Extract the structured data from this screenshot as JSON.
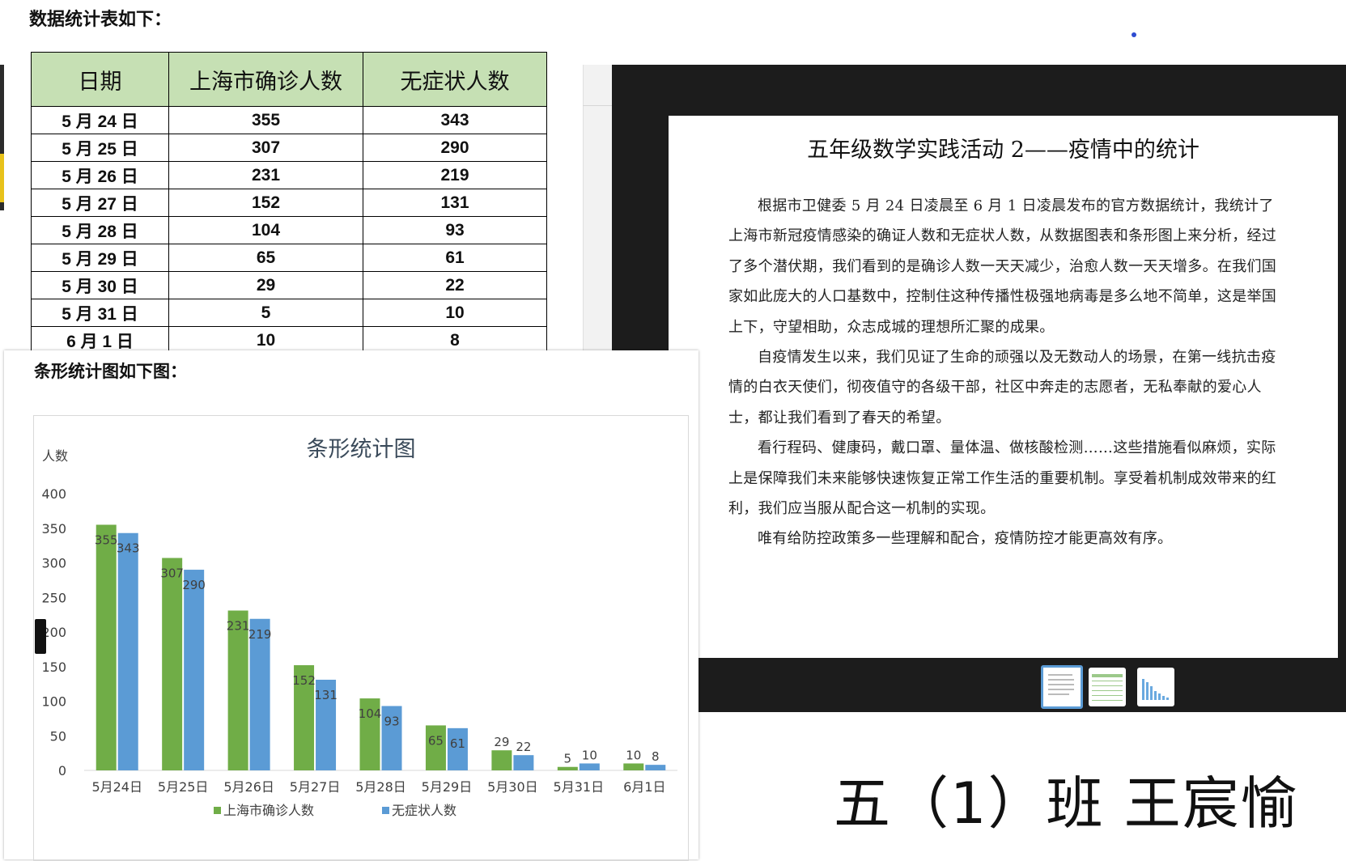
{
  "table_doc": {
    "heading": "数据统计表如下：",
    "headers": [
      "日期",
      "上海市确诊人数",
      "无症状人数"
    ],
    "rows": [
      [
        "5 月 24 日",
        "355",
        "343"
      ],
      [
        "5 月 25 日",
        "307",
        "290"
      ],
      [
        "5 月 26 日",
        "231",
        "219"
      ],
      [
        "5 月 27 日",
        "152",
        "131"
      ],
      [
        "5 月 28 日",
        "104",
        "93"
      ],
      [
        "5 月 29 日",
        "65",
        "61"
      ],
      [
        "5 月 30 日",
        "29",
        "22"
      ],
      [
        "5 月 31 日",
        "5",
        "10"
      ],
      [
        "6 月 1 日",
        "10",
        "8"
      ]
    ]
  },
  "chart_doc": {
    "heading": "条形统计图如下图："
  },
  "chart_data": {
    "type": "bar",
    "title": "条形统计图",
    "ylabel": "人数",
    "xlabel": "",
    "categories": [
      "5月24日",
      "5月25日",
      "5月26日",
      "5月27日",
      "5月28日",
      "5月29日",
      "5月30日",
      "5月31日",
      "6月1日"
    ],
    "series": [
      {
        "name": "上海市确诊人数",
        "values": [
          355,
          307,
          231,
          152,
          104,
          65,
          29,
          5,
          10
        ],
        "color": "#70ad47"
      },
      {
        "name": "无症状人数",
        "values": [
          343,
          290,
          219,
          131,
          93,
          61,
          22,
          10,
          8
        ],
        "color": "#5b9bd5"
      }
    ],
    "ylim": [
      0,
      400
    ],
    "yticks": [
      0,
      50,
      100,
      150,
      200,
      250,
      300,
      350,
      400
    ],
    "legend": "bottom",
    "grid": false
  },
  "essay": {
    "title": "五年级数学实践活动 2——疫情中的统计",
    "paragraphs": [
      "根据市卫健委 5 月 24 日凌晨至 6 月 1 日凌晨发布的官方数据统计，我统计了上海市新冠疫情感染的确证人数和无症状人数，从数据图表和条形图上来分析，经过了多个潜伏期，我们看到的是确诊人数一天天减少，治愈人数一天天增多。在我们国家如此庞大的人口基数中，控制住这种传播性极强地病毒是多么地不简单，这是举国上下，守望相助，众志成城的理想所汇聚的成果。",
      "自疫情发生以来，我们见证了生命的顽强以及无数动人的场景，在第一线抗击疫情的白衣天使们，彻夜值守的各级干部，社区中奔走的志愿者，无私奉献的爱心人士，都让我们看到了春天的希望。",
      "看行程码、健康码，戴口罩、量体温、做核酸检测……这些措施看似麻烦，实际上是保障我们未来能够快速恢复正常工作生活的重要机制。享受着机制成效带来的红利，我们应当服从配合这一机制的实现。",
      "唯有给防控政策多一些理解和配合，疫情防控才能更高效有序。"
    ]
  },
  "author": "五（1）班 王宸愉",
  "colors": {
    "header_green": "#c6e0b4",
    "series_green": "#70ad47",
    "series_blue": "#5b9bd5",
    "viewer_dark": "#1c1c1c"
  }
}
